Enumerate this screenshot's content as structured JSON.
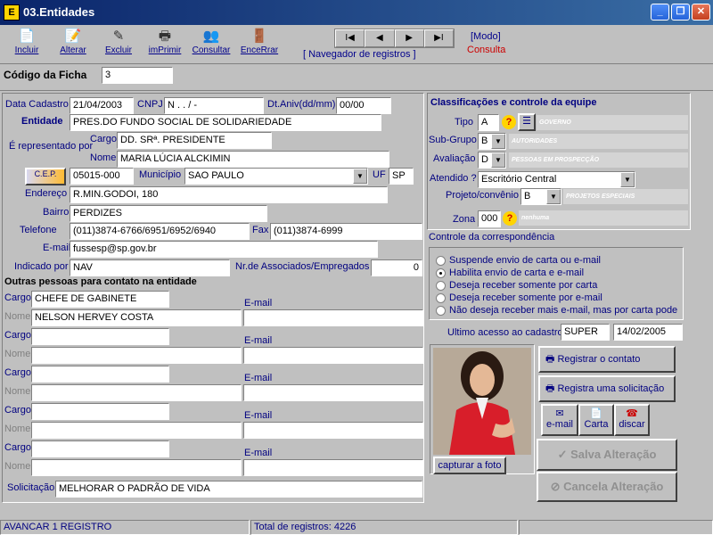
{
  "window": {
    "title": "03.Entidades",
    "icon": "E",
    "min": "_",
    "max": "❐",
    "close": "✕"
  },
  "toolbar": {
    "incluir": "Incluir",
    "alterar": "Alterar",
    "excluir": "Excluir",
    "imprimir": "imPrimir",
    "consultar": "Consultar",
    "encerrar": "EnceRrar"
  },
  "nav": {
    "first": "I◀",
    "prev": "◀",
    "next": "▶",
    "last": "▶I",
    "label": "[ Navegador de registros ]"
  },
  "mode": {
    "label": "[Modo]",
    "value": "Consulta"
  },
  "codigo": {
    "label": "Código da Ficha",
    "value": "3"
  },
  "form": {
    "data_cadastro_label": "Data Cadastro",
    "data_cadastro": "21/04/2003",
    "cnpj_label": "CNPJ",
    "cnpj": "N .  .  /   -",
    "dt_aniv_label": "Dt.Aniv(dd/mm)",
    "dt_aniv": "00/00",
    "entidade_label": "Entidade",
    "entidade": "PRES.DO FUNDO SOCIAL DE SOLIDARIEDADE",
    "representado_label": "É representado por",
    "cargo_label": "Cargo",
    "cargo": "DD. SRª. PRESIDENTE",
    "nome_label": "Nome",
    "nome": "MARIA LÚCIA ALCKIMIN",
    "cep_btn": "C.E.P.",
    "cep": "05015-000",
    "municipio_label": "Município",
    "municipio": "SAO PAULO",
    "uf_label": "UF",
    "uf": "SP",
    "endereco_label": "Endereço",
    "endereco": "R.MIN.GODOI, 180",
    "bairro_label": "Bairro",
    "bairro": "PERDIZES",
    "telefone_label": "Telefone",
    "telefone": "(011)3874-6766/6951/6952/6940",
    "fax_label": "Fax",
    "fax": "(011)3874-6999",
    "email_label": "E-mail",
    "email": "fussesp@sp.gov.br",
    "indicado_label": "Indicado por",
    "indicado": "NAV",
    "associados_label": "Nr.de Associados/Empregados",
    "associados": "0"
  },
  "contacts": {
    "title": "Outras pessoas para contato na entidade",
    "cargo_label": "Cargo",
    "nome_label": "Nome",
    "email_label": "E-mail",
    "rows": [
      {
        "cargo": "CHEFE DE GABINETE",
        "nome": "NELSON HERVEY COSTA",
        "email": ""
      },
      {
        "cargo": "",
        "nome": "",
        "email": ""
      },
      {
        "cargo": "",
        "nome": "",
        "email": ""
      },
      {
        "cargo": "",
        "nome": "",
        "email": ""
      },
      {
        "cargo": "",
        "nome": "",
        "email": ""
      }
    ],
    "solicitacao_label": "Solicitação",
    "solicitacao": "MELHORAR O PADRÃO DE VIDA"
  },
  "classif": {
    "title": "Classificações e controle da equipe",
    "tipo_label": "Tipo",
    "tipo": "A",
    "tipo_desc": "GOVERNO",
    "subgrupo_label": "Sub-Grupo",
    "subgrupo": "B",
    "subgrupo_desc": "AUTORIDADES",
    "avaliacao_label": "Avaliação",
    "avaliacao": "D",
    "avaliacao_desc": "PESSOAS EM PROSPECÇÃO",
    "atendido_label": "Atendido ?",
    "atendido": "Escritório Central",
    "projeto_label": "Projeto/convênio",
    "projeto": "B",
    "projeto_desc": "PROJETOS ESPECIAIS",
    "zona_label": "Zona",
    "zona": "000",
    "zona_desc": "nenhuma"
  },
  "corresp": {
    "title": "Controle da correspondência",
    "options": [
      "Suspende envio de carta ou e-mail",
      "Habilita envio de carta e e-mail",
      "Deseja receber somente por carta",
      "Deseja receber somente por e-mail",
      "Não deseja receber mais e-mail, mas por carta pode"
    ],
    "selected": 1
  },
  "acesso": {
    "label": "Ultimo acesso ao cadastro",
    "user": "SUPER",
    "date": "14/02/2005"
  },
  "actions": {
    "registrar": "Registrar o contato",
    "solicitacao": "Registra uma solicitação",
    "email": "e-mail",
    "carta": "Carta",
    "discar": "discar",
    "capturar": "capturar a foto",
    "salva": "Salva Alteração",
    "cancela": "Cancela Alteração"
  },
  "status": {
    "left": "AVANCAR 1 REGISTRO",
    "total": "Total de registros: 4226"
  }
}
